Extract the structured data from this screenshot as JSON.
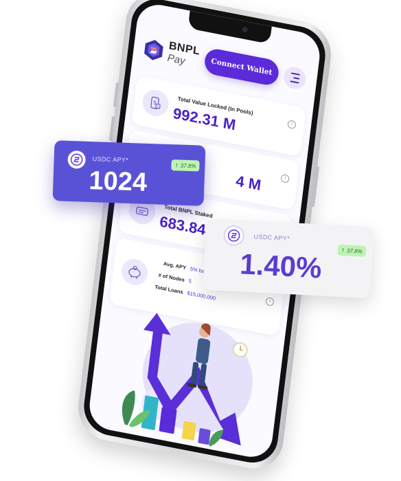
{
  "app": {
    "brand_line1": "BNPL",
    "brand_line2": "Pay",
    "connect_label": "Connect Wallet",
    "menu_icon": "hamburger-icon"
  },
  "stats": [
    {
      "label": "Total Value Locked (In Pools)",
      "value": "992.31 M",
      "icon": "wallet-dollar-icon"
    },
    {
      "label": "",
      "value": "4 M",
      "icon": "coins-icon"
    },
    {
      "label": "Total BNPL Staked",
      "value": "683.84 M",
      "icon": "cash-icon"
    }
  ],
  "metrics": {
    "icon": "piggy-bank-icon",
    "avg_apy_label": "Avg. APY",
    "avg_apy_value": "5% base + 85% BNPL",
    "nodes_label": "# of Nodes",
    "nodes_value": "5",
    "loans_label": "Total Loans",
    "loans_value": "$15,000,000"
  },
  "float_cards": [
    {
      "label": "USDC APY*",
      "value": "1024",
      "change": "37.8%",
      "icon": "usdc-coin-icon"
    },
    {
      "label": "USDC APY*",
      "value": "1.40%",
      "change": "37.8%",
      "icon": "usdc-coin-icon"
    }
  ],
  "colors": {
    "primary": "#5b2bd9",
    "card_purple": "#5a52d6",
    "value_text": "#4a22c9",
    "badge_green": "#bff3b5"
  }
}
